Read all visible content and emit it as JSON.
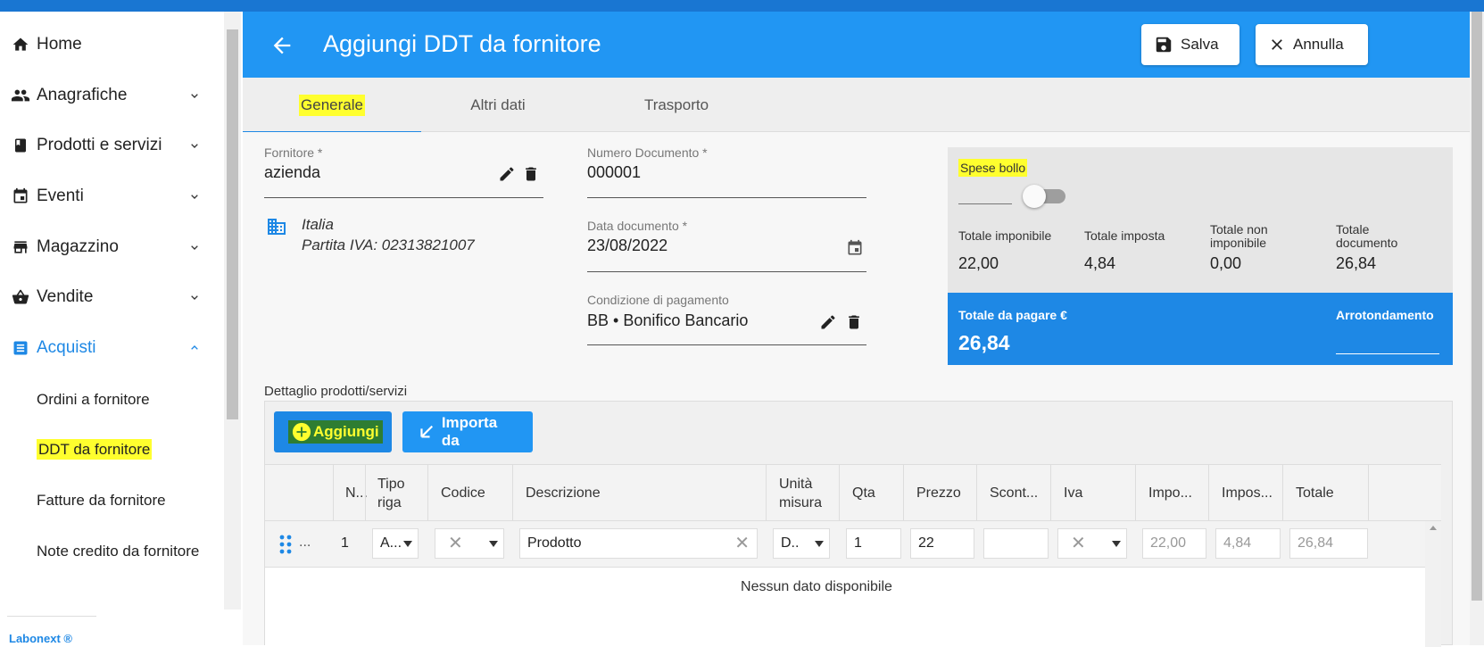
{
  "sidebar": {
    "items": [
      {
        "label": "Home",
        "icon": "home-icon"
      },
      {
        "label": "Anagrafiche",
        "icon": "people-icon"
      },
      {
        "label": "Prodotti e servizi",
        "icon": "book-icon"
      },
      {
        "label": "Eventi",
        "icon": "calendar-icon"
      },
      {
        "label": "Magazzino",
        "icon": "store-icon"
      },
      {
        "label": "Vendite",
        "icon": "basket-icon"
      },
      {
        "label": "Acquisti",
        "icon": "list-icon"
      }
    ],
    "subitems": [
      "Ordini a fornitore",
      "DDT da fornitore",
      "Fatture da fornitore",
      "Note credito da fornitore"
    ],
    "brand": "Labonext ®"
  },
  "header": {
    "title": "Aggiungi DDT da fornitore",
    "save_label": "Salva",
    "cancel_label": "Annulla"
  },
  "tabs": [
    "Generale",
    "Altri dati",
    "Trasporto"
  ],
  "form": {
    "fornitore_label": "Fornitore *",
    "fornitore_value": "azienda",
    "country": "Italia",
    "vat": "Partita IVA: 02313821007",
    "numero_label": "Numero Documento *",
    "numero_value": "000001",
    "data_label": "Data documento *",
    "data_value": "23/08/2022",
    "pagamento_label": "Condizione di pagamento",
    "pagamento_value": "BB • Bonifico Bancario"
  },
  "summary": {
    "spese_bollo": "Spese bollo",
    "spese_bollo_on": false,
    "imponibile_label": "Totale imponibile",
    "imponibile_value": "22,00",
    "imposta_label": "Totale imposta",
    "imposta_value": "4,84",
    "non_imponibile_label": "Totale non imponibile",
    "non_imponibile_value": "0,00",
    "documento_label": "Totale documento",
    "documento_value": "26,84",
    "da_pagare_label": "Totale da pagare €",
    "da_pagare_value": "26,84",
    "arrotondamento_label": "Arrotondamento"
  },
  "details": {
    "section_label": "Dettaglio prodotti/servizi",
    "add_label": "Aggiungi",
    "import_label": "Importa da",
    "columns": [
      "N...",
      "Tipo riga",
      "Codice",
      "Descrizione",
      "Unità misura",
      "Qta",
      "Prezzo",
      "Scont...",
      "Iva",
      "Impo...",
      "Impos...",
      "Totale"
    ],
    "row": {
      "handle_dots": "...",
      "n": "1",
      "tipo": "A...",
      "descrizione": "Prodotto",
      "unita": "D..",
      "qta": "1",
      "prezzo": "22",
      "imponibile": "22,00",
      "imposta": "4,84",
      "totale": "26,84"
    },
    "no_data": "Nessun dato disponibile"
  },
  "colors": {
    "primary": "#2196f3",
    "active": "#1e88e5",
    "highlight": "#ffff2e"
  }
}
